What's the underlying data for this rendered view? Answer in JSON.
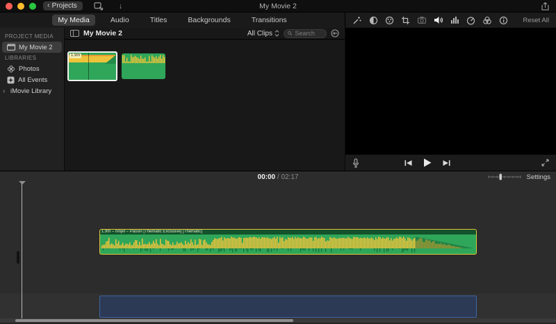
{
  "colors": {
    "clip_green": "#2fa659",
    "clip_green_dark": "#157038",
    "wave_yellow": "#eec33b",
    "selection_yellow": "#e3c63c",
    "music_well_blue": "#3f66a3",
    "traffic_red": "#ff5f57",
    "traffic_yellow": "#febc2e",
    "traffic_green": "#28c840"
  },
  "titlebar": {
    "back_button": "Projects",
    "title": "My Movie 2",
    "icons": [
      "media-import-icon",
      "download-arrow-icon",
      "share-icon"
    ]
  },
  "tabs": {
    "items": [
      "My Media",
      "Audio",
      "Titles",
      "Backgrounds",
      "Transitions"
    ],
    "selected": "My Media"
  },
  "sidebar": {
    "sections": [
      {
        "header": "PROJECT MEDIA",
        "items": [
          {
            "label": "My Movie 2",
            "icon": "clapper-icon",
            "selected": true
          }
        ]
      },
      {
        "header": "LIBRARIES",
        "items": [
          {
            "label": "Photos",
            "icon": "photos-icon"
          },
          {
            "label": "All Events",
            "icon": "events-icon"
          },
          {
            "label": "iMovie Library",
            "icon": "disclosure-right",
            "disclosure": "›"
          }
        ]
      }
    ]
  },
  "browser": {
    "title": "My Movie 2",
    "filter_value": "All Clips",
    "search_placeholder": "Search",
    "appearance_icon": "clip-appearance-icon",
    "clips": [
      {
        "duration_badge": "1.9m",
        "selected": true
      },
      {
        "selected": false
      }
    ]
  },
  "viewer": {
    "toolbar_icons": [
      "auto-enhance-wand-icon",
      "color-balance-icon",
      "color-correction-icon",
      "crop-icon",
      "stabilization-icon",
      "volume-icon",
      "noise-eq-icon",
      "speed-icon",
      "filters-icon",
      "info-icon"
    ],
    "reset_all_label": "Reset All",
    "controls": [
      "voiceover-mic-icon",
      "previous-frame-icon",
      "play-icon",
      "next-frame-icon",
      "fullscreen-icon"
    ]
  },
  "timeline": {
    "current_time": "00:00",
    "time_separator": " / ",
    "total_time": "02:17",
    "settings_label": "Settings",
    "zoom_slider": "clip-zoom-slider",
    "clip_label": "1.9m – ninjel – Passin [Thematic Exclusive] [Thematic]"
  }
}
